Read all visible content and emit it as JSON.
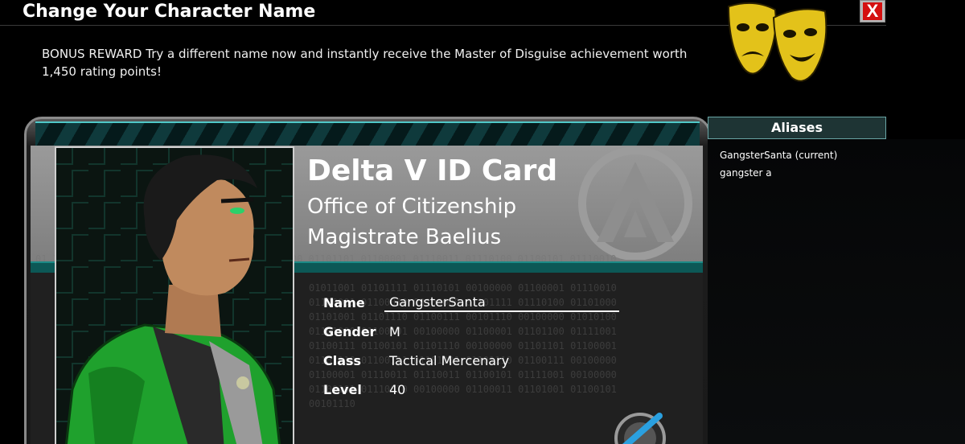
{
  "window": {
    "title": "Change Your Character Name",
    "close_label": "X"
  },
  "bonus_text": "BONUS REWARD Try a different name now and instantly receive the Master of Disguise achievement worth 1,450 rating points!",
  "card": {
    "title": "Delta V ID Card",
    "office": "Office of Citizenship",
    "magistrate": "Magistrate Baelius",
    "binary_top": "01 11001 01 01111  0110   010 1110010 01100000 01101101 01100001 01110011 01110100 01100101 01110010",
    "binary_lower": "01011001 01101111 01110101 00100000 01100001 01110010\n01100001 01100010 00100000 01101111 01110100 01101000\n01101001 01101110 01100111 00101110 00100000 01010100\n01101000 01100101 00100000 01100001 01101100 01111001\n01100111 01100101 01101110 00100000 01101101 01100001\n01101110 01100111 01101001 01101110 01100111 00100000\n01100001 01110011 01110011 01100101 01111001 00100000\n01100101 01110010 00100000 01100011 01101001 01100101\n00101110",
    "fields": {
      "name_label": "Name",
      "name_value": "GangsterSanta",
      "gender_label": "Gender",
      "gender_value": "M",
      "class_label": "Class",
      "class_value": "Tactical Mercenary",
      "level_label": "Level",
      "level_value": "40"
    }
  },
  "aliases": {
    "header": "Aliases",
    "items": [
      "GangsterSanta (current)",
      "gangster a"
    ]
  },
  "icons": {
    "masks": "theater-masks-icon",
    "emblem": "delta-v-emblem-icon",
    "confirm": "confirm-button-icon",
    "close": "close-icon"
  },
  "colors": {
    "teal_accent": "#0c5856",
    "close_red": "#d41010",
    "jacket_green": "#1fa12d",
    "mask_gold": "#e3c21a"
  }
}
